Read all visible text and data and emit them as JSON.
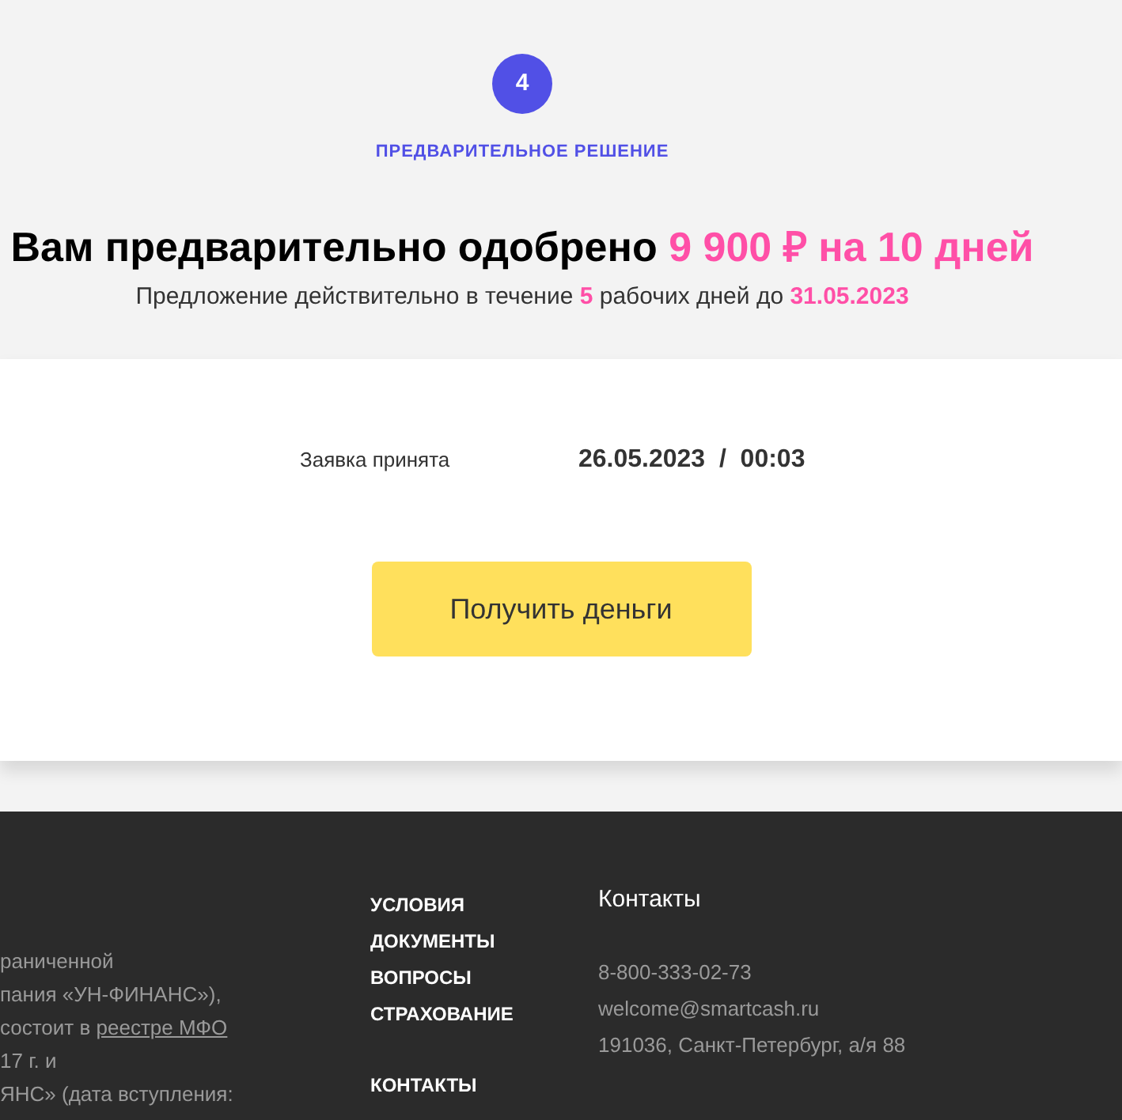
{
  "step": {
    "number": "4",
    "label": "ПРЕДВАРИТЕЛЬНОЕ РЕШЕНИЕ"
  },
  "headline": {
    "text": "Вам предварительно одобрено ",
    "highlight": "9 900 ₽ на 10 дней"
  },
  "subline": {
    "parts": [
      {
        "text": "Предложение действительно в течение ",
        "accent": false
      },
      {
        "text": "5",
        "accent": true
      },
      {
        "text": " рабочих дней до ",
        "accent": false
      },
      {
        "text": "31.05.2023",
        "accent": true
      }
    ]
  },
  "application": {
    "label": "Заявка принята",
    "date": "26.05.2023",
    "separator": "/",
    "time": "00:03"
  },
  "button": {
    "label": "Получить деньги"
  },
  "footer": {
    "about_lines": [
      {
        "text": "раниченной"
      },
      {
        "text": "пания «УН-ФИНАНС»),"
      },
      {
        "text": "состоит в ",
        "link": "реестре МФО"
      },
      {
        "text": "17 г. и"
      },
      {
        "text": "ЯНС» (дата вступления:"
      }
    ],
    "links": [
      {
        "label": "УСЛОВИЯ"
      },
      {
        "label": "ДОКУМЕНТЫ"
      },
      {
        "label": "ВОПРОСЫ"
      },
      {
        "label": "СТРАХОВАНИЕ"
      },
      {
        "label": "КОНТАКТЫ"
      }
    ],
    "contacts": {
      "title": "Контакты",
      "phone": "8-800-333-02-73",
      "email": "welcome@smartcash.ru",
      "address": "191036, Санкт-Петербург, а/я 88"
    }
  }
}
